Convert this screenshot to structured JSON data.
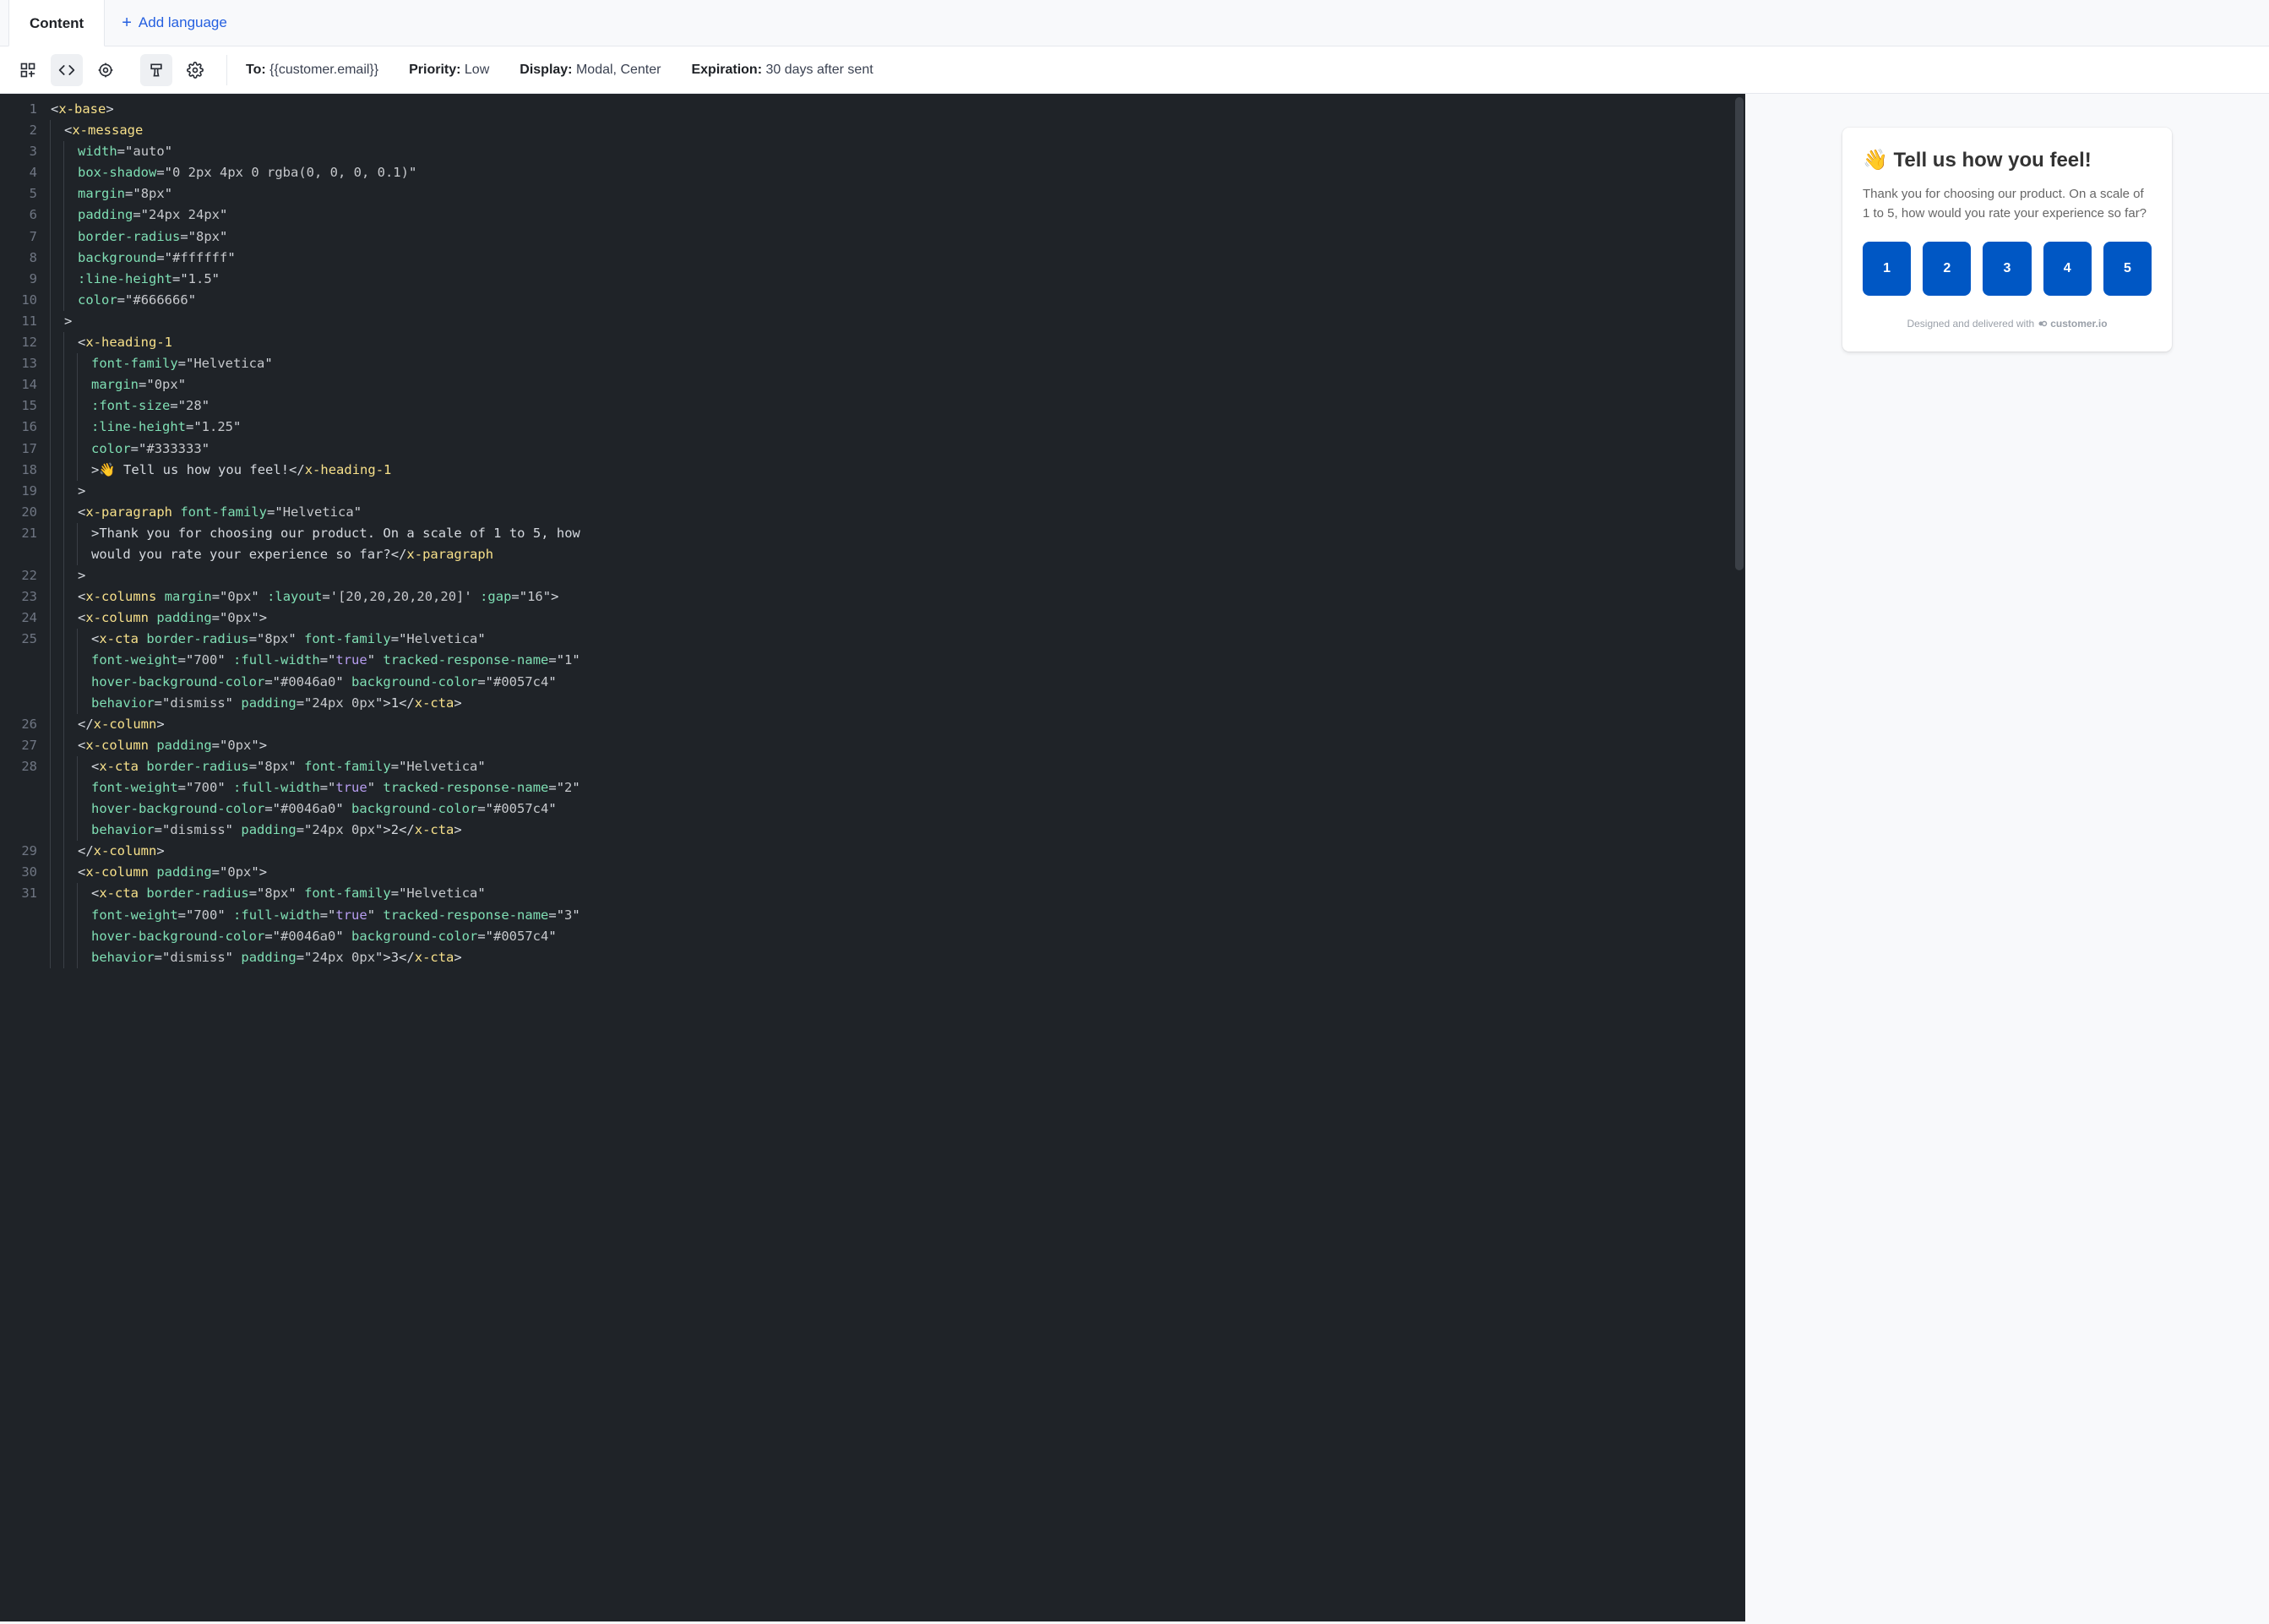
{
  "tabs": {
    "content_label": "Content",
    "add_language_label": "Add language"
  },
  "toolbar": {
    "icons": [
      {
        "name": "components-icon"
      },
      {
        "name": "code-icon"
      },
      {
        "name": "target-icon"
      },
      {
        "name": "brush-icon"
      },
      {
        "name": "gear-icon"
      }
    ],
    "meta": {
      "to_label": "To:",
      "to_value": "{{customer.email}}",
      "priority_label": "Priority:",
      "priority_value": "Low",
      "display_label": "Display:",
      "display_value": "Modal, Center",
      "expiration_label": "Expiration:",
      "expiration_value": "30 days after sent"
    }
  },
  "editor": {
    "line_numbers": [
      "1",
      "2",
      "3",
      "4",
      "5",
      "6",
      "7",
      "8",
      "9",
      "10",
      "11",
      "12",
      "13",
      "14",
      "15",
      "16",
      "17",
      "18",
      "19",
      "20",
      "21",
      "22",
      "23",
      "24",
      "25",
      "26",
      "27",
      "28",
      "29",
      "30",
      "31"
    ],
    "code_raw": "<x-base>\n  <x-message\n    width=\"auto\"\n    box-shadow=\"0 2px 4px 0 rgba(0, 0, 0, 0.1)\"\n    margin=\"8px\"\n    padding=\"24px 24px\"\n    border-radius=\"8px\"\n    background=\"#ffffff\"\n    :line-height=\"1.5\"\n    color=\"#666666\"\n  >\n    <x-heading-1\n      font-family=\"Helvetica\"\n      margin=\"0px\"\n      :font-size=\"28\"\n      :line-height=\"1.25\"\n      color=\"#333333\"\n      >👋 Tell us how you feel!</x-heading-1\n    >\n    <x-paragraph font-family=\"Helvetica\"\n      >Thank you for choosing our product. On a scale of 1 to 5, how\n      would you rate your experience so far?</x-paragraph\n    >\n    <x-columns margin=\"0px\" :layout='[20,20,20,20,20]' :gap=\"16\">\n    <x-column padding=\"0px\">\n      <x-cta border-radius=\"8px\" font-family=\"Helvetica\"\n      font-weight=\"700\" :full-width=\"true\" tracked-response-name=\"1\"\n      hover-background-color=\"#0046a0\" background-color=\"#0057c4\"\n      behavior=\"dismiss\" padding=\"24px 0px\">1</x-cta>\n    </x-column>\n    <x-column padding=\"0px\">\n      <x-cta border-radius=\"8px\" font-family=\"Helvetica\"\n      font-weight=\"700\" :full-width=\"true\" tracked-response-name=\"2\"\n      hover-background-color=\"#0046a0\" background-color=\"#0057c4\"\n      behavior=\"dismiss\" padding=\"24px 0px\">2</x-cta>\n    </x-column>\n    <x-column padding=\"0px\">\n      <x-cta border-radius=\"8px\" font-family=\"Helvetica\"\n      font-weight=\"700\" :full-width=\"true\" tracked-response-name=\"3\"\n      hover-background-color=\"#0046a0\" background-color=\"#0057c4\"\n      behavior=\"dismiss\" padding=\"24px 0px\">3</x-cta>"
  },
  "preview": {
    "heading": "👋 Tell us how you feel!",
    "paragraph": "Thank you for choosing our product. On a scale of 1 to 5, how would you rate your experience so far?",
    "ctas": [
      "1",
      "2",
      "3",
      "4",
      "5"
    ],
    "footer_text": "Designed and delivered with",
    "footer_brand": "customer.io"
  }
}
